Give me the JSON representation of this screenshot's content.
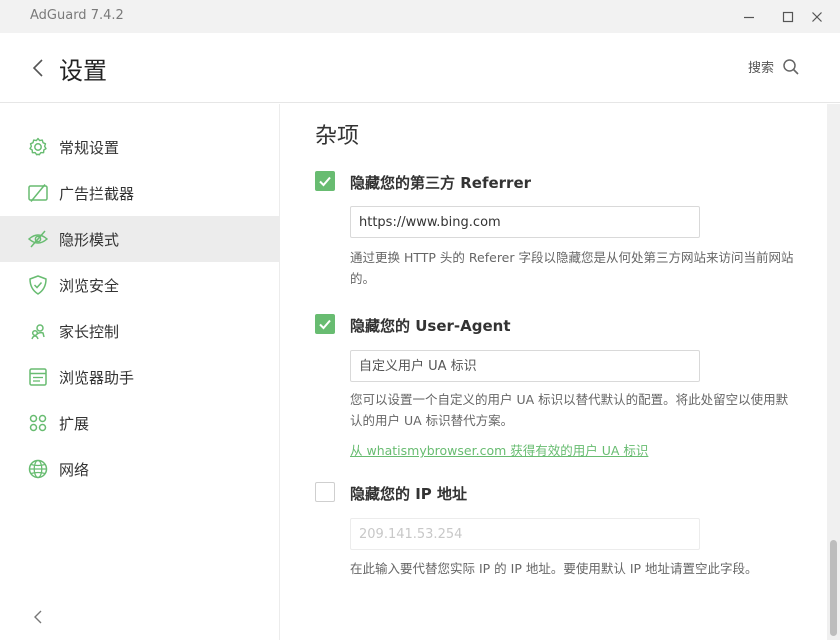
{
  "window": {
    "title": "AdGuard 7.4.2"
  },
  "header": {
    "title": "设置",
    "search_label": "搜索"
  },
  "sidebar": {
    "items": [
      {
        "label": "常规设置",
        "icon": "gear-icon"
      },
      {
        "label": "广告拦截器",
        "icon": "ad-block-icon"
      },
      {
        "label": "隐形模式",
        "icon": "eye-slash-icon",
        "active": true
      },
      {
        "label": "浏览安全",
        "icon": "shield-check-icon"
      },
      {
        "label": "家长控制",
        "icon": "parental-control-icon"
      },
      {
        "label": "浏览器助手",
        "icon": "browser-assistant-icon"
      },
      {
        "label": "扩展",
        "icon": "extensions-grid-icon"
      },
      {
        "label": "网络",
        "icon": "globe-icon"
      }
    ]
  },
  "content": {
    "section_title": "杂项",
    "referrer": {
      "label": "隐藏您的第三方 Referrer",
      "checked": true,
      "value": "https://www.bing.com",
      "description": "通过更换 HTTP 头的 Referer 字段以隐藏您是从何处第三方网站来访问当前网站的。"
    },
    "user_agent": {
      "label": "隐藏您的 User-Agent",
      "checked": true,
      "placeholder": "自定义用户 UA 标识",
      "description": "您可以设置一个自定义的用户 UA 标识以替代默认的配置。将此处留空以使用默认的用户 UA 标识替代方案。",
      "link": "从 whatismybrowser.com 获得有效的用户 UA 标识"
    },
    "ip": {
      "label": "隐藏您的 IP 地址",
      "checked": false,
      "placeholder": "209.141.53.254",
      "description": "在此输入要代替您实际 IP 的 IP 地址。要使用默认 IP 地址请置空此字段。"
    }
  },
  "colors": {
    "accent": "#68bc71",
    "titlebar_bg": "#f2f2f2",
    "active_item_bg": "#ececec"
  }
}
